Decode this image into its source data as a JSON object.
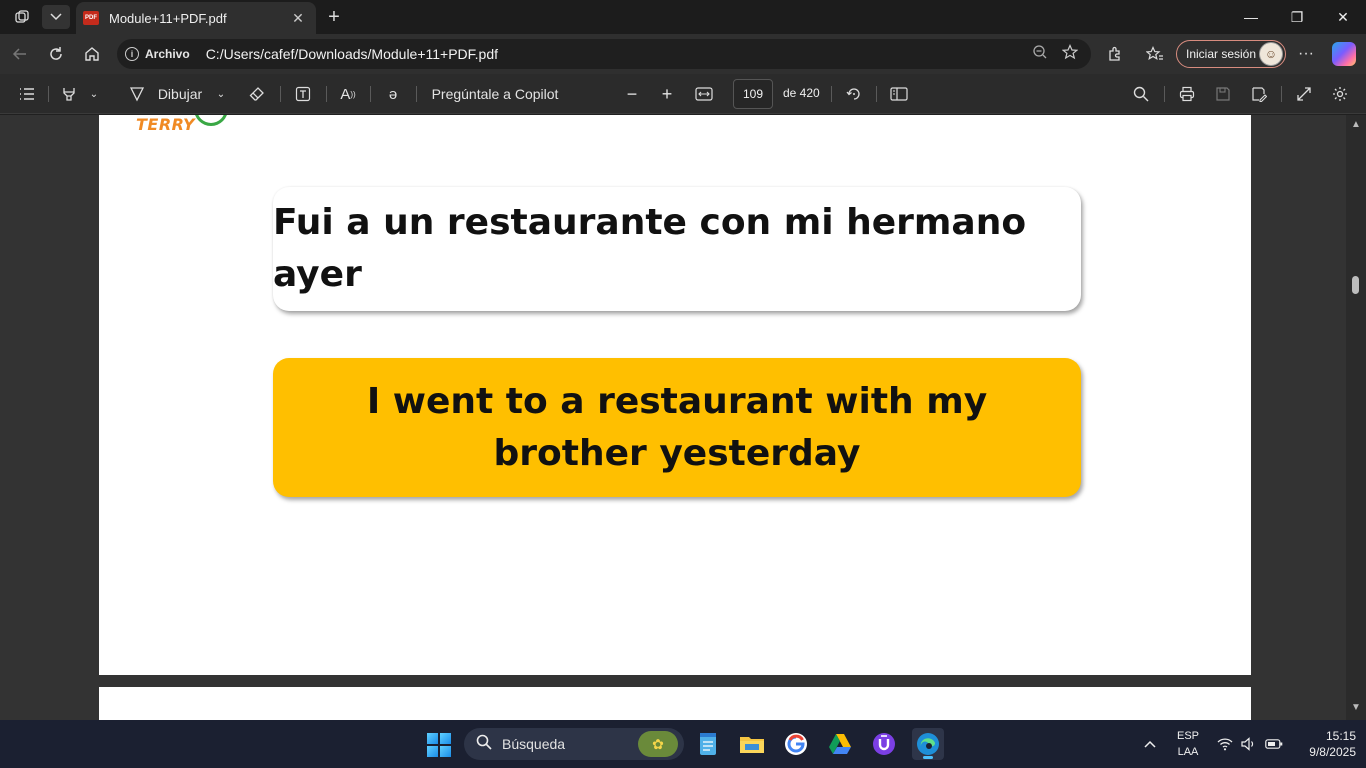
{
  "window": {
    "tab_title": "Module+11+PDF.pdf",
    "tab_favicon": "PDF",
    "minimize": "—",
    "maximize": "❐",
    "close": "✕",
    "new_tab": "+"
  },
  "address_bar": {
    "scheme_label": "Archivo",
    "url": "C:/Users/cafef/Downloads/Module+11+PDF.pdf",
    "signin_label": "Iniciar sesión"
  },
  "pdf_toolbar": {
    "draw_label": "Dibujar",
    "copilot_label": "Pregúntale a Copilot",
    "current_page": "109",
    "page_of": "de 420"
  },
  "document": {
    "logo_text": "TERRY",
    "spanish_phrase": "Fui a un restaurante con mi hermano ayer",
    "english_phrase": "I went to a restaurant with my brother yesterday",
    "english_card_color": "#FFBF00"
  },
  "taskbar": {
    "search_placeholder": "Búsqueda",
    "language_line1": "ESP",
    "language_line2": "LAA",
    "time": "15:15",
    "date": "9/8/2025"
  }
}
